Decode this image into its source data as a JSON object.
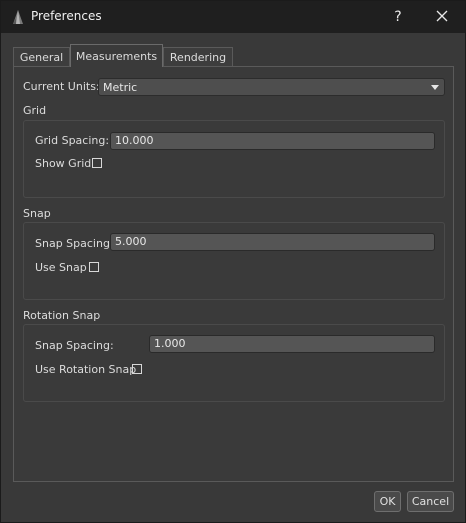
{
  "window": {
    "title": "Preferences",
    "help_label": "?"
  },
  "tabs": [
    {
      "label": "General"
    },
    {
      "label": "Measurements"
    },
    {
      "label": "Rendering"
    }
  ],
  "active_tab": "Measurements",
  "units": {
    "label": "Current Units:",
    "value": "Metric"
  },
  "grid": {
    "title": "Grid",
    "spacing_label": "Grid Spacing:",
    "spacing_value": "10.000",
    "show_label": "Show Grid",
    "show_checked": false
  },
  "snap": {
    "title": "Snap",
    "spacing_label": "Snap Spacing:",
    "spacing_value": "5.000",
    "use_label": "Use Snap",
    "use_checked": false
  },
  "rotation_snap": {
    "title": "Rotation Snap",
    "spacing_label": "Snap Spacing:",
    "spacing_value": "1.000",
    "use_label": "Use Rotation Snap",
    "use_checked": false
  },
  "buttons": {
    "ok_label": "OK",
    "cancel_label": "Cancel"
  }
}
